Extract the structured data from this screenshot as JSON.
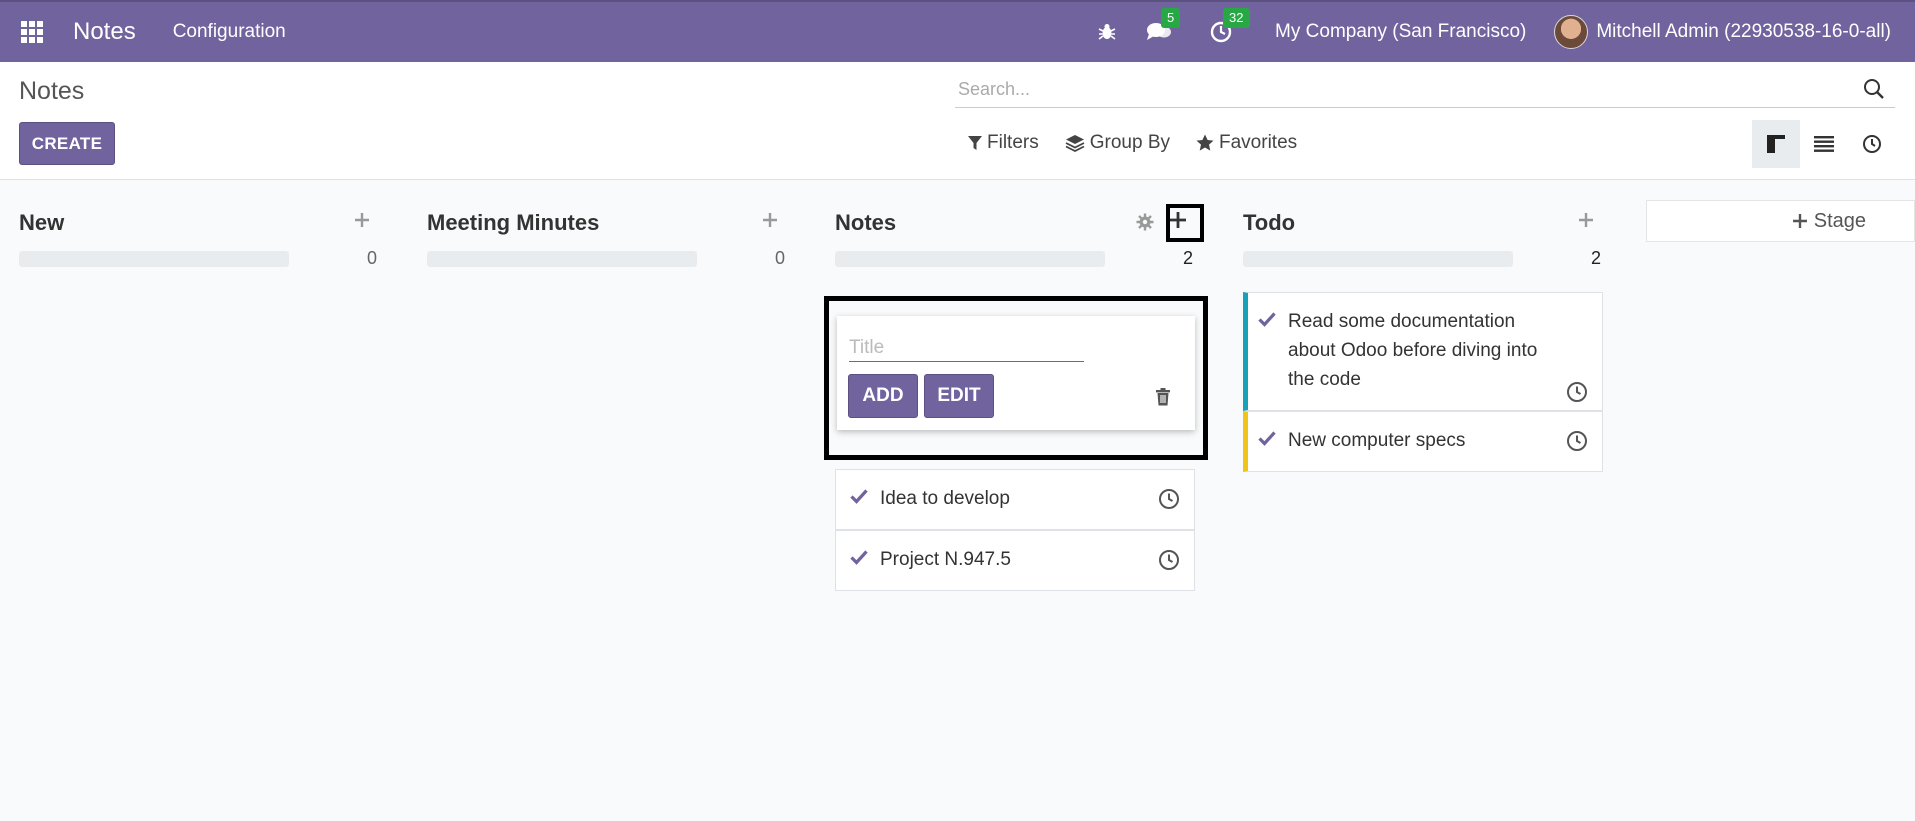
{
  "navbar": {
    "app_name": "Notes",
    "menu_configuration": "Configuration",
    "messages_count": "5",
    "activities_count": "32",
    "company": "My Company (San Francisco)",
    "user": "Mitchell Admin (22930538-16-0-all)"
  },
  "control_panel": {
    "breadcrumb": "Notes",
    "create_label": "CREATE",
    "search_placeholder": "Search...",
    "filters_label": "Filters",
    "group_by_label": "Group By",
    "favorites_label": "Favorites"
  },
  "columns": [
    {
      "title": "New",
      "count": "0",
      "cards": []
    },
    {
      "title": "Meeting Minutes",
      "count": "0",
      "cards": []
    },
    {
      "title": "Notes",
      "count": "2",
      "cards": [
        {
          "text": "Idea to develop"
        },
        {
          "text": "Project N.947.5"
        }
      ]
    },
    {
      "title": "Todo",
      "count": "2",
      "cards": [
        {
          "text": "Read some documentation about Odoo before diving into the code",
          "color": "#17a2b8"
        },
        {
          "text": "New computer specs",
          "color": "#f0c419"
        }
      ]
    }
  ],
  "quick_create": {
    "title_placeholder": "Title",
    "add_label": "ADD",
    "edit_label": "EDIT"
  },
  "add_stage_label": "Stage",
  "colors": {
    "brand": "#71639e",
    "badge": "#28a745"
  }
}
